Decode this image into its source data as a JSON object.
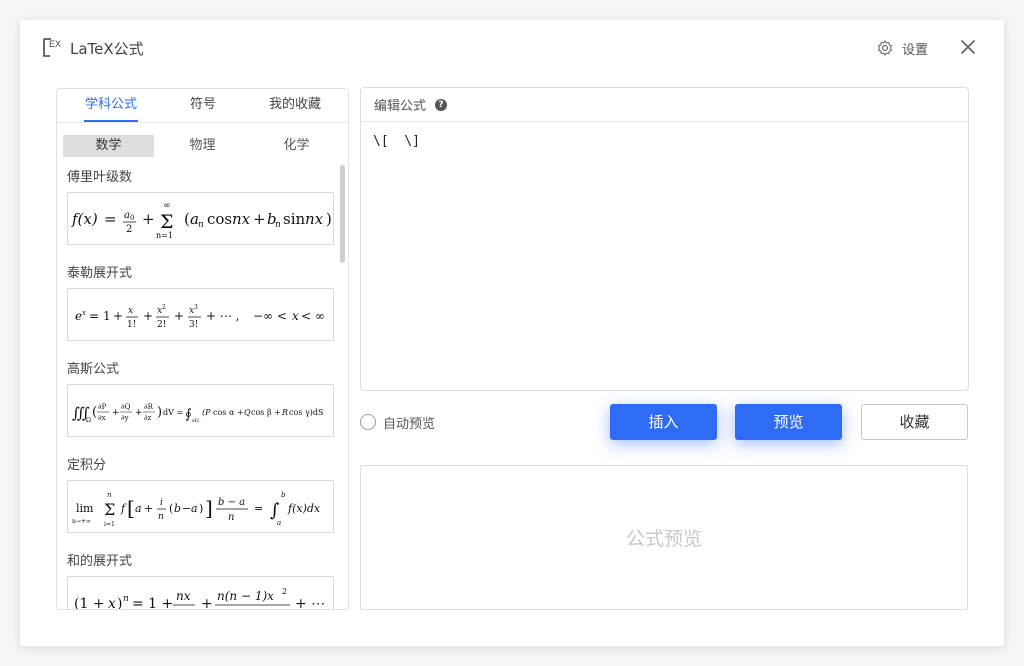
{
  "app": {
    "logo_text": "TEX",
    "title": "LaTeX公式"
  },
  "header": {
    "settings_label": "设置"
  },
  "left_panel": {
    "tabs": [
      {
        "label": "学科公式",
        "active": true
      },
      {
        "label": "符号",
        "active": false
      },
      {
        "label": "我的收藏",
        "active": false
      }
    ],
    "subtabs": [
      {
        "label": "数学",
        "active": true
      },
      {
        "label": "物理",
        "active": false
      },
      {
        "label": "化学",
        "active": false
      }
    ],
    "formulas": [
      {
        "name": "傅里叶级数",
        "latex": "f(x) = \\frac{a_0}{2} + \\sum_{n=1}^{\\infty} (a_n \\cos nx + b_n \\sin nx)"
      },
      {
        "name": "泰勒展开式",
        "latex": "e^x = 1 + \\frac{x}{1!} + \\frac{x^2}{2!} + \\frac{x^3}{3!} + \\cdots, \\quad -\\infty < x < \\infty"
      },
      {
        "name": "高斯公式",
        "latex": "\\iiint_\\Omega (\\frac{\\partial P}{\\partial x} + \\frac{\\partial Q}{\\partial y} + \\frac{\\partial R}{\\partial z}) dV = \\oint_{\\partial\\Omega} (P\\cos\\alpha + Q\\cos\\beta + R\\cos\\gamma) dS"
      },
      {
        "name": "定积分",
        "latex": "\\lim_{n\\to+\\infty} \\sum_{i=1}^{n} f[a + \\frac{i}{n}(b-a)] \\frac{b-a}{n} = \\int_a^b f(x)dx"
      },
      {
        "name": "和的展开式",
        "latex": "(1+x)^n = 1 + \\frac{nx}{1!} + \\frac{n(n-1)x^2}{2!} + \\cdots"
      }
    ]
  },
  "editor": {
    "header_label": "编辑公式",
    "help_glyph": "?",
    "content": "\\[  \\]"
  },
  "controls": {
    "auto_preview_label": "自动预览",
    "auto_preview_checked": false,
    "insert_label": "插入",
    "preview_label": "预览",
    "favorite_label": "收藏"
  },
  "preview": {
    "placeholder": "公式预览"
  },
  "colors": {
    "accent": "#2e6cf6",
    "tab_active": "#2f6ef0"
  }
}
